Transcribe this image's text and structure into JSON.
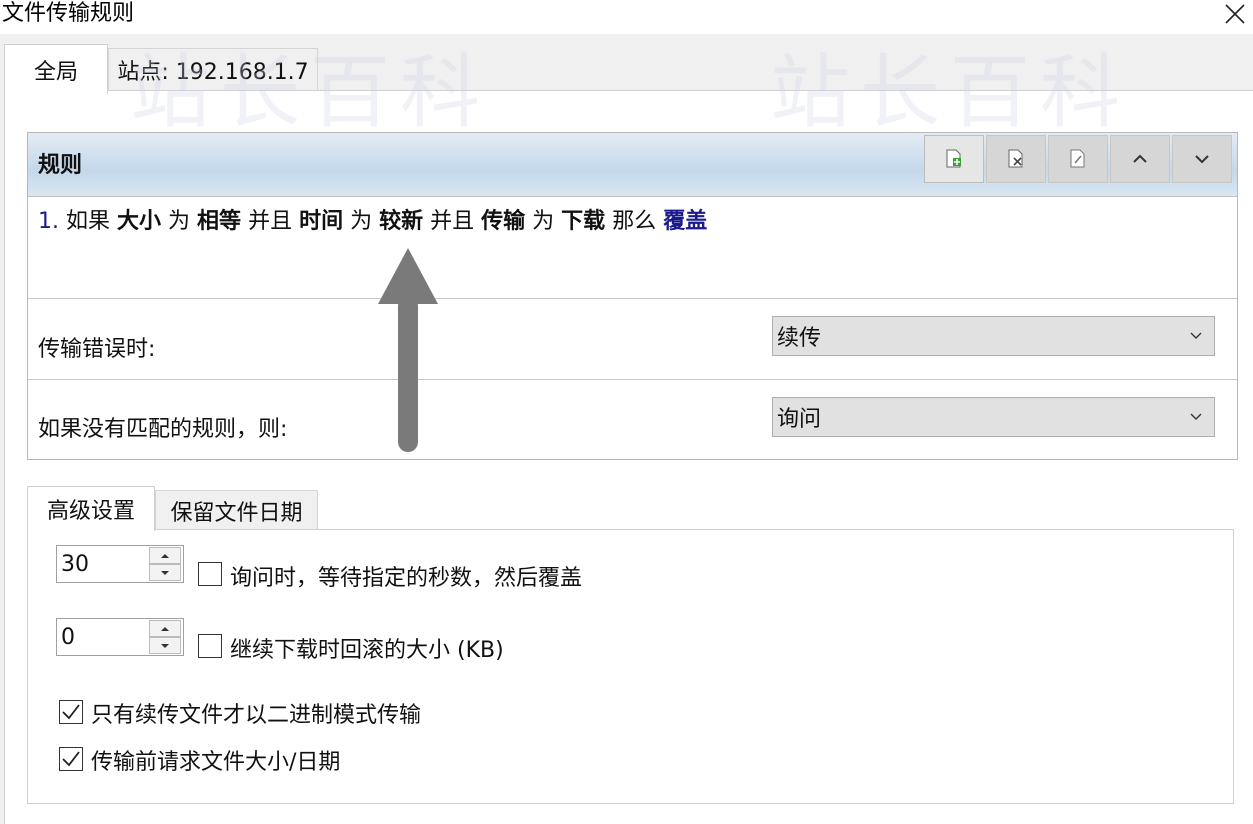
{
  "window": {
    "title": "文件传输规则"
  },
  "tabs": [
    {
      "label": "全局",
      "active": true
    },
    {
      "label": "站点: 192.168.1.7",
      "active": false
    }
  ],
  "rules_panel": {
    "header": "规则",
    "toolbar": [
      {
        "name": "add-rule-button",
        "icon": "add-document-icon"
      },
      {
        "name": "delete-rule-button",
        "icon": "delete-document-icon"
      },
      {
        "name": "edit-rule-button",
        "icon": "edit-document-icon"
      },
      {
        "name": "move-up-button",
        "icon": "chevron-up-icon"
      },
      {
        "name": "move-down-button",
        "icon": "chevron-down-icon"
      }
    ],
    "rule_line": {
      "index": "1.",
      "t1": "如果",
      "size": "大小",
      "is1": "为",
      "equal": "相等",
      "and1": "并且",
      "time": "时间",
      "is2": "为",
      "newer": "较新",
      "and2": "并且",
      "transfer": "传输",
      "is3": "为",
      "download": "下载",
      "then": "那么",
      "action": "覆盖"
    }
  },
  "on_error": {
    "label": "传输错误时:",
    "value": "续传"
  },
  "no_match": {
    "label": "如果没有匹配的规则，则:",
    "value": "询问"
  },
  "bottom_tabs": [
    {
      "label": "高级设置",
      "active": true
    },
    {
      "label": "保留文件日期",
      "active": false
    }
  ],
  "advanced": {
    "wait_seconds": {
      "value": "30",
      "label": "询问时，等待指定的秒数，然后覆盖",
      "checked": false
    },
    "rollback": {
      "value": "0",
      "label": "继续下载时回滚的大小 (KB)",
      "checked": false
    },
    "binary_resume": {
      "label": "只有续传文件才以二进制模式传输",
      "checked": true
    },
    "request_size": {
      "label": "传输前请求文件大小/日期",
      "checked": true
    }
  },
  "watermark": "站长百科",
  "colors": {
    "header_gradient": "#c4d8ea",
    "action_text": "#1a1a8c",
    "arrow": "#7a7a7a"
  }
}
